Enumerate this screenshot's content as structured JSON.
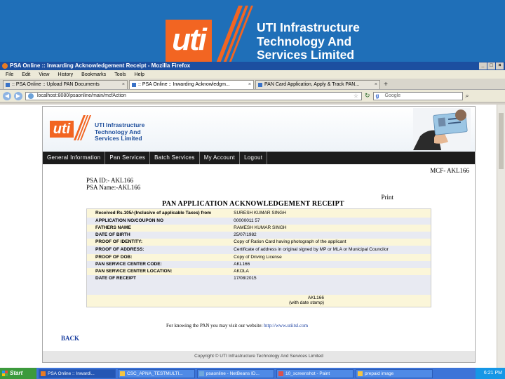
{
  "banner": {
    "logo_text": "uti",
    "title_lines": [
      "UTI Infrastructure",
      "Technology And",
      "Services Limited"
    ]
  },
  "browser": {
    "window_title": "PSA Online :: Inwarding Acknowledgement Receipt - Mozilla Firefox",
    "menu": [
      "File",
      "Edit",
      "View",
      "History",
      "Bookmarks",
      "Tools",
      "Help"
    ],
    "tabs": [
      {
        "label": ":: PSA Online :: Upload PAN Documents",
        "active": false
      },
      {
        "label": ":: PSA Online :: Inwarding Acknowledgm...",
        "active": true
      },
      {
        "label": "PAN Card Application, Apply & Track PAN...",
        "active": false
      }
    ],
    "url": "localhost:8080/psaonline/main/mcfAction",
    "search_engine": "Google",
    "search_placeholder": "Google"
  },
  "site": {
    "logo_text": "uti",
    "title_lines": [
      "UTI Infrastructure",
      "Technology And",
      "Services Limited"
    ],
    "nav": [
      "General Information",
      "Pan Services",
      "Batch Services",
      "My Account",
      "Logout"
    ],
    "mcf_id": "MCF- AKL166",
    "psa_id_label": "PSA ID:- AKL166",
    "psa_name_label": "PSA Name:-AKL166",
    "print_label": "Print",
    "receipt_title": "PAN APPLICATION ACKNOWLEDGEMENT RECEIPT",
    "rows": [
      {
        "label": "Received Rs.105/-(Inclusive of applicable Taxes) from",
        "value": "SURESH KUMAR SINGH"
      },
      {
        "label": "APPLICATION NO/COUPON NO",
        "value": "00000011 57"
      },
      {
        "label": "FATHERS NAME",
        "value": "RAMESH KUMAR SINGH"
      },
      {
        "label": "DATE OF BIRTH",
        "value": "25/07/1982"
      },
      {
        "label": "PROOF OF IDENTITY:",
        "value": "Copy of Ration Card having photograph of the applicant"
      },
      {
        "label": "PROOF OF ADDRESS:",
        "value": "Certificate of address in original signed by MP or MLA or Municipal Councilor"
      },
      {
        "label": "PROOF OF DOB:",
        "value": "Copy of Driving License"
      },
      {
        "label": "PAN SERVICE CENTER CODE:",
        "value": "AKL166"
      },
      {
        "label": "PAN SERVICE CENTER LOCATION:",
        "value": "AKOLA"
      },
      {
        "label": "DATE OF RECEIPT",
        "value": "17/08/2015"
      }
    ],
    "sign_line1": "AKL166",
    "sign_line2": "(with date stamp)",
    "pan_note": "For knowing the PAN you may visit our website: ",
    "pan_note_link": "http://www.utiitsl.com",
    "back_label": "BACK",
    "footer": "Copyright © UTI Infrastructure Technology And Services Limited"
  },
  "taskbar": {
    "start_label": "Start",
    "tasks": [
      {
        "label": "PSA Online :: Inwardi...",
        "active": true
      },
      {
        "label": "CSC_APNA_TESTMULTI...",
        "active": false
      },
      {
        "label": "psaonline - NetBeans ID...",
        "active": false
      },
      {
        "label": "10_screenshot - Paint",
        "active": false
      },
      {
        "label": "prepaid image",
        "active": false
      }
    ],
    "clock": "6:21 PM"
  },
  "colors": {
    "slide_blue": "#1f6fb8",
    "uti_orange": "#f26522",
    "nav_black": "#1c1c1c",
    "row_yellow": "#fbf6d9",
    "row_blue": "#e8eaf2"
  }
}
